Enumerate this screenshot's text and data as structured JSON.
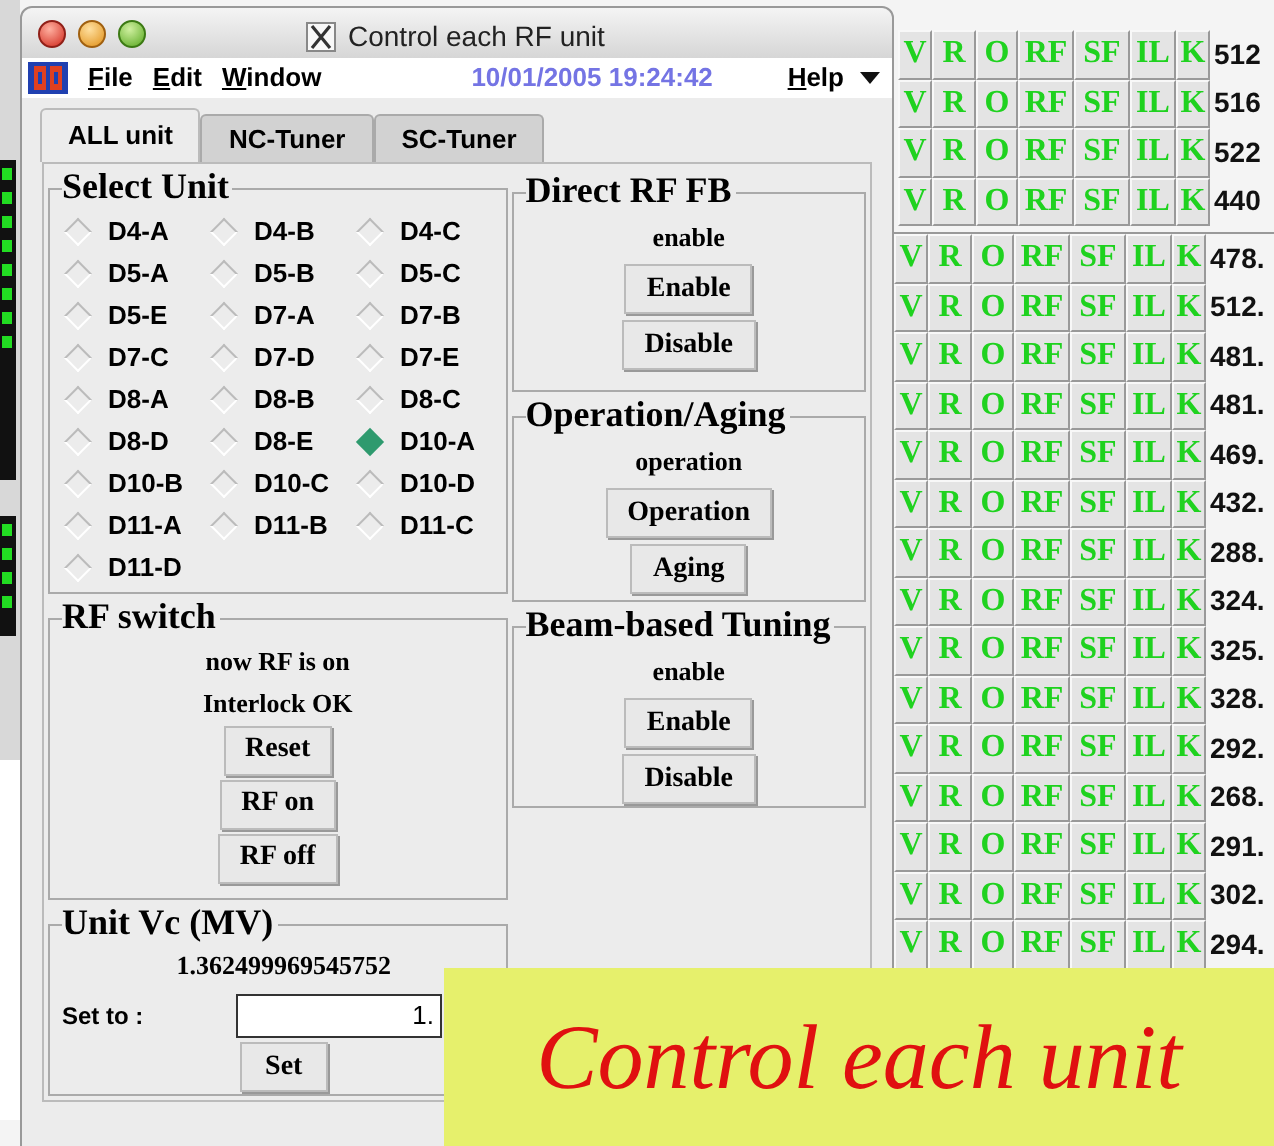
{
  "window": {
    "title": "Control each RF unit"
  },
  "menu": [
    "File",
    "Edit",
    "Window"
  ],
  "clock": "10/01/2005 19:24:42",
  "help": "Help",
  "tabs": [
    {
      "label": "ALL unit",
      "selected": true
    },
    {
      "label": "NC-Tuner",
      "selected": false
    },
    {
      "label": "SC-Tuner",
      "selected": false
    }
  ],
  "select_unit": {
    "title": "Select Unit",
    "units": [
      {
        "label": "D4-A",
        "selected": false
      },
      {
        "label": "D4-B",
        "selected": false
      },
      {
        "label": "D4-C",
        "selected": false
      },
      {
        "label": "D5-A",
        "selected": false
      },
      {
        "label": "D5-B",
        "selected": false
      },
      {
        "label": "D5-C",
        "selected": false
      },
      {
        "label": "D5-E",
        "selected": false
      },
      {
        "label": "D7-A",
        "selected": false
      },
      {
        "label": "D7-B",
        "selected": false
      },
      {
        "label": "D7-C",
        "selected": false
      },
      {
        "label": "D7-D",
        "selected": false
      },
      {
        "label": "D7-E",
        "selected": false
      },
      {
        "label": "D8-A",
        "selected": false
      },
      {
        "label": "D8-B",
        "selected": false
      },
      {
        "label": "D8-C",
        "selected": false
      },
      {
        "label": "D8-D",
        "selected": false
      },
      {
        "label": "D8-E",
        "selected": false
      },
      {
        "label": "D10-A",
        "selected": true
      },
      {
        "label": "D10-B",
        "selected": false
      },
      {
        "label": "D10-C",
        "selected": false
      },
      {
        "label": "D10-D",
        "selected": false
      },
      {
        "label": "D11-A",
        "selected": false
      },
      {
        "label": "D11-B",
        "selected": false
      },
      {
        "label": "D11-C",
        "selected": false
      },
      {
        "label": "D11-D",
        "selected": false
      }
    ]
  },
  "rf_switch": {
    "title": "RF switch",
    "status": [
      "now RF is on",
      "Interlock OK"
    ],
    "buttons": [
      "Reset",
      "RF on",
      "RF off"
    ]
  },
  "unit_vc": {
    "title": "Unit Vc (MV)",
    "reading": "1.362499969545752",
    "set_label": "Set to :",
    "value": "1.",
    "button": "Set"
  },
  "side_panels": [
    {
      "title": "Direct RF FB",
      "state": "enable",
      "buttons": [
        "Enable",
        "Disable"
      ]
    },
    {
      "title": "Operation/Aging",
      "state": "operation",
      "buttons": [
        "Operation",
        "Aging"
      ]
    },
    {
      "title": "Beam-based Tuning",
      "state": "enable",
      "buttons": [
        "Enable",
        "Disable"
      ]
    }
  ],
  "unit_status": {
    "top_rows": [
      {
        "flags": [
          "V",
          "R",
          "O",
          "RF",
          "SF",
          "IL",
          "K"
        ],
        "value": "512"
      },
      {
        "flags": [
          "V",
          "R",
          "O",
          "RF",
          "SF",
          "IL",
          "K"
        ],
        "value": "516"
      },
      {
        "flags": [
          "V",
          "R",
          "O",
          "RF",
          "SF",
          "IL",
          "K"
        ],
        "value": "522"
      },
      {
        "flags": [
          "V",
          "R",
          "O",
          "RF",
          "SF",
          "IL",
          "K"
        ],
        "value": "440"
      }
    ],
    "rows": [
      {
        "flags": [
          "V",
          "R",
          "O",
          "RF",
          "SF",
          "IL",
          "K"
        ],
        "value": "478."
      },
      {
        "flags": [
          "V",
          "R",
          "O",
          "RF",
          "SF",
          "IL",
          "K"
        ],
        "value": "512."
      },
      {
        "flags": [
          "V",
          "R",
          "O",
          "RF",
          "SF",
          "IL",
          "K"
        ],
        "value": "481."
      },
      {
        "flags": [
          "V",
          "R",
          "O",
          "RF",
          "SF",
          "IL",
          "K"
        ],
        "value": "481."
      },
      {
        "flags": [
          "V",
          "R",
          "O",
          "RF",
          "SF",
          "IL",
          "K"
        ],
        "value": "469."
      },
      {
        "flags": [
          "V",
          "R",
          "O",
          "RF",
          "SF",
          "IL",
          "K"
        ],
        "value": "432."
      },
      {
        "flags": [
          "V",
          "R",
          "O",
          "RF",
          "SF",
          "IL",
          "K"
        ],
        "value": "288."
      },
      {
        "flags": [
          "V",
          "R",
          "O",
          "RF",
          "SF",
          "IL",
          "K"
        ],
        "value": "324."
      },
      {
        "flags": [
          "V",
          "R",
          "O",
          "RF",
          "SF",
          "IL",
          "K"
        ],
        "value": "325."
      },
      {
        "flags": [
          "V",
          "R",
          "O",
          "RF",
          "SF",
          "IL",
          "K"
        ],
        "value": "328."
      },
      {
        "flags": [
          "V",
          "R",
          "O",
          "RF",
          "SF",
          "IL",
          "K"
        ],
        "value": "292."
      },
      {
        "flags": [
          "V",
          "R",
          "O",
          "RF",
          "SF",
          "IL",
          "K"
        ],
        "value": "268."
      },
      {
        "flags": [
          "V",
          "R",
          "O",
          "RF",
          "SF",
          "IL",
          "K"
        ],
        "value": "291."
      },
      {
        "flags": [
          "V",
          "R",
          "O",
          "RF",
          "SF",
          "IL",
          "K"
        ],
        "value": "302."
      },
      {
        "flags": [
          "V",
          "R",
          "O",
          "RF",
          "SF",
          "IL",
          "K"
        ],
        "value": "294."
      }
    ]
  },
  "caption": "Control each unit"
}
